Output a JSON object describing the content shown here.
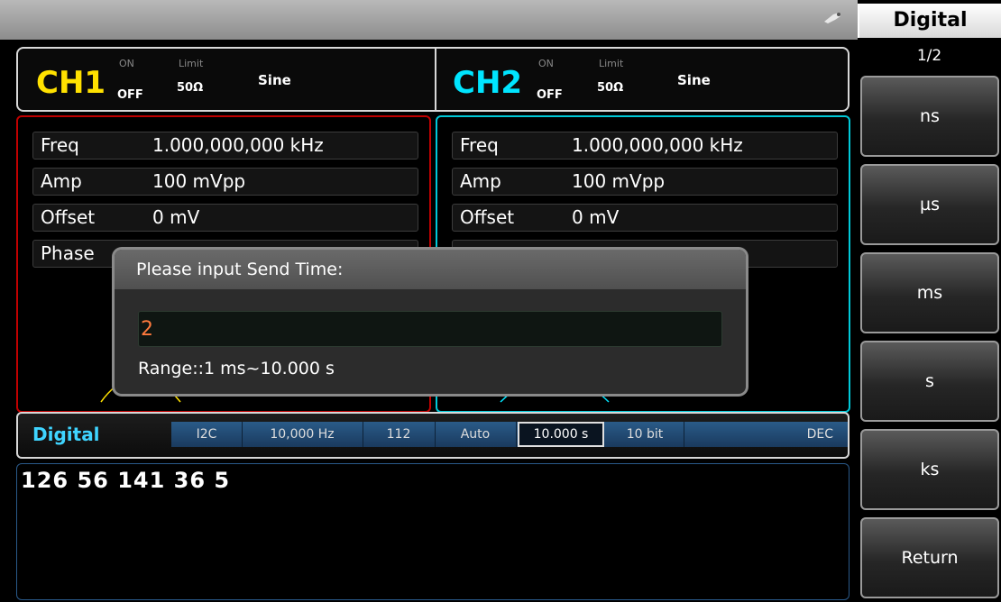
{
  "topbar": {
    "usb_icon": "usb-icon"
  },
  "softkeys": {
    "title": "Digital",
    "page": "1/2",
    "buttons": [
      "ns",
      "µs",
      "ms",
      "s",
      "ks",
      "Return"
    ]
  },
  "channels": {
    "ch1": {
      "label": "CH1",
      "on": "ON",
      "off": "OFF",
      "limit": "Limit",
      "impedance": "50Ω",
      "wave": "Sine",
      "color": "#ffe100"
    },
    "ch2": {
      "label": "CH2",
      "on": "ON",
      "off": "OFF",
      "limit": "Limit",
      "impedance": "50Ω",
      "wave": "Sine",
      "color": "#00e5ff"
    }
  },
  "ch1_params": [
    {
      "key": "Freq",
      "value": "1.000,000,000 kHz"
    },
    {
      "key": "Amp",
      "value": "100 mVpp"
    },
    {
      "key": "Offset",
      "value": "0 mV"
    },
    {
      "key": "Phase",
      "value": ""
    }
  ],
  "ch2_params": [
    {
      "key": "Freq",
      "value": "1.000,000,000 kHz"
    },
    {
      "key": "Amp",
      "value": "100 mVpp"
    },
    {
      "key": "Offset",
      "value": "0 mV"
    },
    {
      "key": "",
      "value": ""
    }
  ],
  "digital_bar": {
    "title": "Digital",
    "protocol": "I2C",
    "rate": "10,000 Hz",
    "address": "112",
    "mode": "Auto",
    "send_time": "10.000 s",
    "bits": "10 bit",
    "format": "DEC"
  },
  "data_area": {
    "text": "126 56 141 36 5"
  },
  "dialog": {
    "title": "Please input Send Time:",
    "input_value": "2",
    "range": "Range::1 ms~10.000 s"
  }
}
